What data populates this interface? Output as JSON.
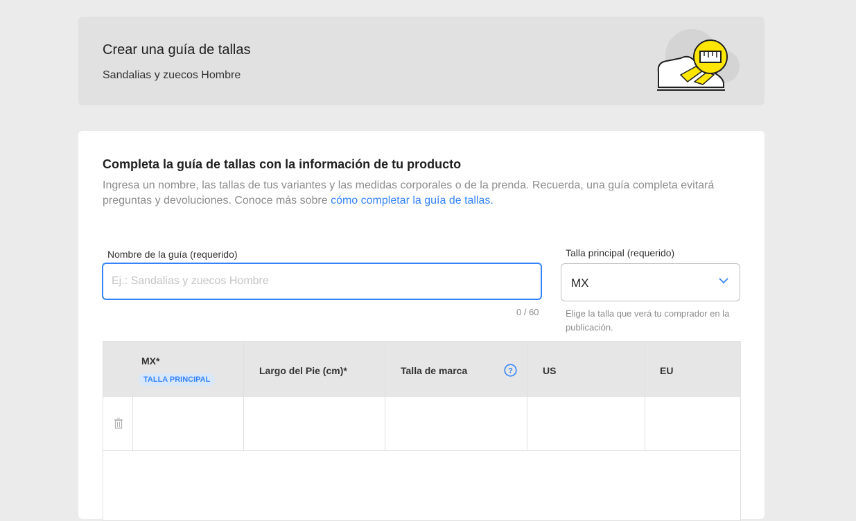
{
  "header": {
    "title": "Crear una guía de tallas",
    "subtitle": "Sandalias y zuecos Hombre",
    "illustration_icon": "shoe-ruler-icon"
  },
  "main": {
    "title": "Completa la guía de tallas con la información de tu producto",
    "description": "Ingresa un nombre, las tallas de tus variantes y las medidas corporales o de la prenda. Recuerda, una guía completa evitará preguntas y devoluciones. Conoce más sobre ",
    "link_text": "cómo completar la guía de tallas."
  },
  "form": {
    "name_label": "Nombre de la guía (requerido)",
    "name_placeholder": "Ej.: Sandalias y zuecos Hombre",
    "name_value": "",
    "counter": "0 / 60",
    "size_label": "Talla principal (requerido)",
    "size_value": "MX",
    "size_help": "Elige la talla que verá tu comprador en la publicación."
  },
  "table": {
    "columns": [
      {
        "label": "MX*",
        "badge": "TALLA PRINCIPAL"
      },
      {
        "label": "Largo del Pie (cm)*"
      },
      {
        "label": "Talla de marca",
        "icon": "help-icon"
      },
      {
        "label": "US"
      },
      {
        "label": "EU"
      }
    ],
    "rows": [
      {
        "cells": [
          "",
          "",
          "",
          "",
          ""
        ]
      }
    ]
  },
  "colors": {
    "accent": "#3483fa",
    "brand_yellow": "#ffe600",
    "header_bg": "#e1e1e1",
    "page_bg": "#ebebeb"
  }
}
